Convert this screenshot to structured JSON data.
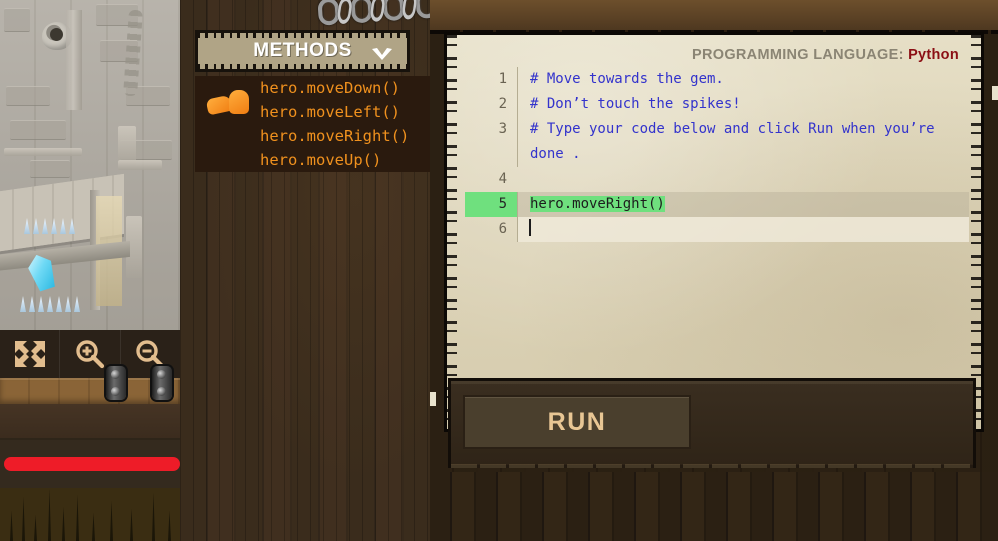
{
  "game": {
    "name": "code-combat-level-view",
    "gem_label": "gem",
    "controls": [
      {
        "name": "fullscreen-icon",
        "label": "Fullscreen"
      },
      {
        "name": "zoom-in-icon",
        "label": "Zoom In"
      },
      {
        "name": "zoom-out-icon",
        "label": "Zoom Out"
      }
    ],
    "health": {
      "label": "Health",
      "percent": 100,
      "color": "#ee1c28"
    }
  },
  "methods_panel": {
    "title": "METHODS",
    "chevron": "⌄",
    "items": [
      {
        "label": "hero.moveDown()"
      },
      {
        "label": "hero.moveLeft()"
      },
      {
        "label": "hero.moveRight()"
      },
      {
        "label": "hero.moveUp()"
      }
    ],
    "icon_name": "boots-icon",
    "text_color": "#f0911e"
  },
  "editor": {
    "language_label": "PROGRAMMING LANGUAGE:",
    "language_value": "Python",
    "language_value_color": "#8b0f14",
    "lines": [
      {
        "number": "1",
        "text": "# Move towards the gem.",
        "type": "comment"
      },
      {
        "number": "2",
        "text": "# Don’t touch the spikes!",
        "type": "comment"
      },
      {
        "number": "3",
        "text": "# Type your code below and click Run when you’re done .",
        "type": "comment"
      },
      {
        "number": "4",
        "text": "",
        "type": "blank"
      },
      {
        "number": "5",
        "text": "hero.moveRight()",
        "type": "code",
        "selected": true,
        "has_run_arrow": true
      },
      {
        "number": "6",
        "text": "",
        "type": "code",
        "cursor": true
      }
    ],
    "selection_color": "#6fe07e"
  },
  "run_bar": {
    "run_label": "RUN"
  }
}
